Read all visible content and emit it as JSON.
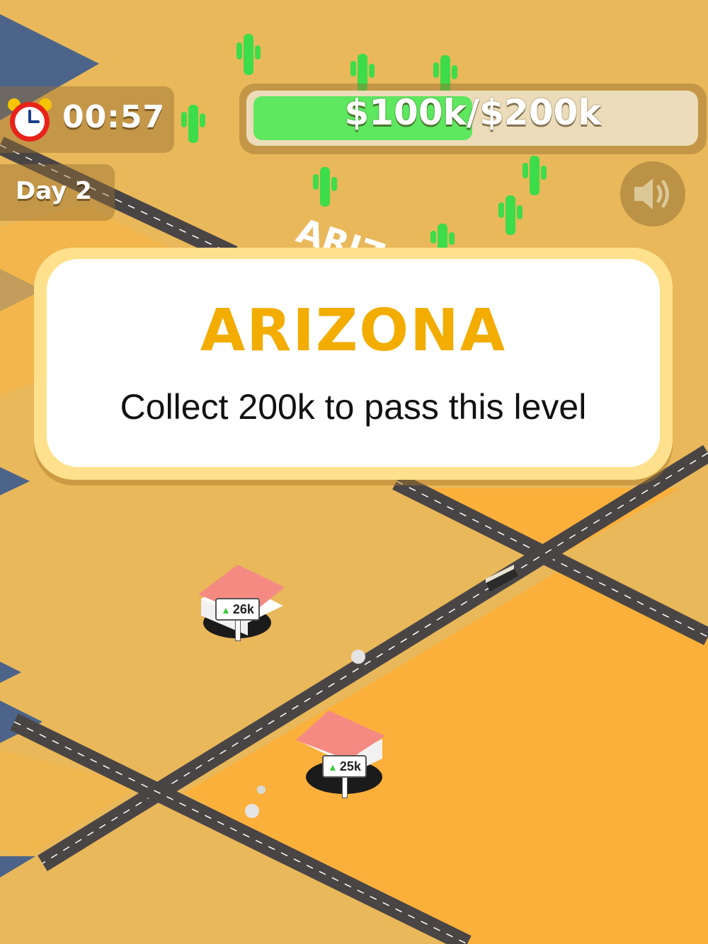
{
  "hud": {
    "timer": "00:57",
    "day_label": "Day 2",
    "progress_label": "$100k/$200k",
    "progress_fraction": 0.5
  },
  "world": {
    "ground_text": "ARIZ",
    "houses": [
      {
        "price": "26k"
      },
      {
        "price": "25k"
      }
    ]
  },
  "level_popup": {
    "title": "ARIZONA",
    "subtitle": "Collect 200k to pass this level"
  },
  "colors": {
    "ground": "#e9b85a",
    "lot": "#fbb03b",
    "road": "#4a4545",
    "accent": "#f2ad00",
    "progress": "#5de860",
    "water": "#4c6489"
  },
  "icons": [
    "alarm-clock-icon",
    "speaker-icon",
    "cactus-icon",
    "house-icon",
    "bus-icon",
    "up-arrow-icon"
  ]
}
